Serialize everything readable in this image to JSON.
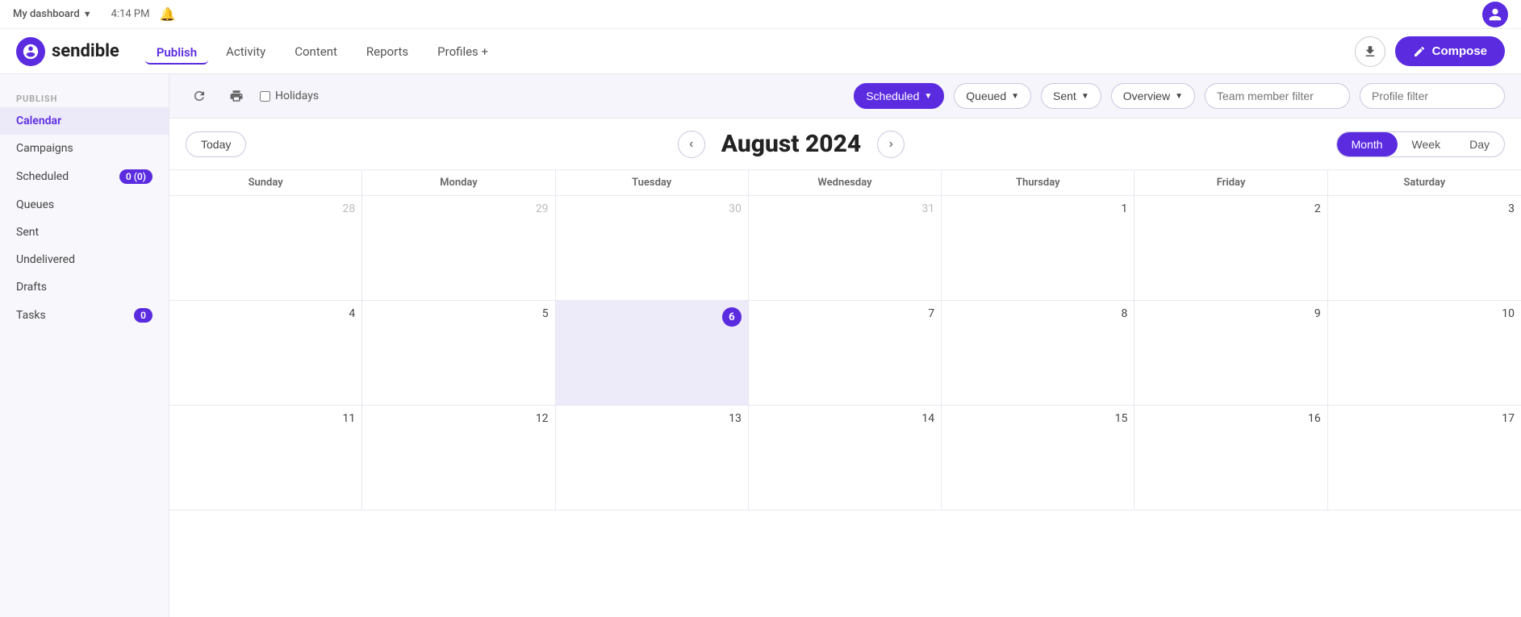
{
  "topbar": {
    "time": "4:14 PM",
    "dashboard_label": "My dashboard",
    "logo_text": "sendible"
  },
  "nav": {
    "links": [
      {
        "label": "Publish",
        "active": true
      },
      {
        "label": "Activity",
        "active": false
      },
      {
        "label": "Content",
        "active": false
      },
      {
        "label": "Reports",
        "active": false
      },
      {
        "label": "Profiles +",
        "active": false
      }
    ],
    "compose_label": "Compose"
  },
  "sidebar": {
    "section_label": "PUBLISH",
    "items": [
      {
        "label": "Calendar",
        "active": true,
        "badge": null
      },
      {
        "label": "Campaigns",
        "active": false,
        "badge": null
      },
      {
        "label": "Scheduled",
        "active": false,
        "badge": "0 (0)"
      },
      {
        "label": "Queues",
        "active": false,
        "badge": null
      },
      {
        "label": "Sent",
        "active": false,
        "badge": null
      },
      {
        "label": "Undelivered",
        "active": false,
        "badge": null
      },
      {
        "label": "Drafts",
        "active": false,
        "badge": null
      },
      {
        "label": "Tasks",
        "active": false,
        "badge": "0"
      }
    ]
  },
  "toolbar": {
    "holidays_label": "Holidays",
    "scheduled_label": "Scheduled",
    "queued_label": "Queued",
    "sent_label": "Sent",
    "overview_label": "Overview",
    "team_member_placeholder": "Team member filter",
    "profile_filter_placeholder": "Profile filter"
  },
  "calendar": {
    "today_label": "Today",
    "title": "August 2024",
    "view_month": "Month",
    "view_week": "Week",
    "view_day": "Day",
    "day_headers": [
      "Sunday",
      "Monday",
      "Tuesday",
      "Wednesday",
      "Thursday",
      "Friday",
      "Saturday"
    ],
    "weeks": [
      [
        {
          "num": "28",
          "other": true,
          "today": false
        },
        {
          "num": "29",
          "other": true,
          "today": false
        },
        {
          "num": "30",
          "other": true,
          "today": false
        },
        {
          "num": "31",
          "other": true,
          "today": false
        },
        {
          "num": "1",
          "other": false,
          "today": false
        },
        {
          "num": "2",
          "other": false,
          "today": false
        },
        {
          "num": "3",
          "other": false,
          "today": false
        }
      ],
      [
        {
          "num": "4",
          "other": false,
          "today": false
        },
        {
          "num": "5",
          "other": false,
          "today": false
        },
        {
          "num": "6",
          "other": false,
          "today": true
        },
        {
          "num": "7",
          "other": false,
          "today": false
        },
        {
          "num": "8",
          "other": false,
          "today": false
        },
        {
          "num": "9",
          "other": false,
          "today": false
        },
        {
          "num": "10",
          "other": false,
          "today": false
        }
      ],
      [
        {
          "num": "11",
          "other": false,
          "today": false
        },
        {
          "num": "12",
          "other": false,
          "today": false
        },
        {
          "num": "13",
          "other": false,
          "today": false
        },
        {
          "num": "14",
          "other": false,
          "today": false
        },
        {
          "num": "15",
          "other": false,
          "today": false
        },
        {
          "num": "16",
          "other": false,
          "today": false
        },
        {
          "num": "17",
          "other": false,
          "today": false
        }
      ]
    ]
  }
}
